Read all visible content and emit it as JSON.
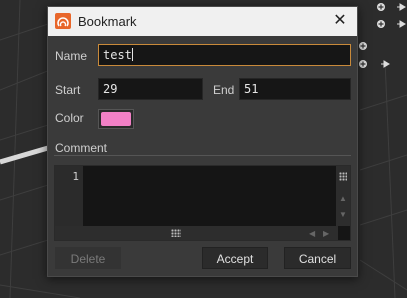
{
  "dialog": {
    "title": "Bookmark",
    "close_glyph": "✕",
    "name_label": "Name",
    "name_value": "test",
    "start_label": "Start",
    "start_value": "29",
    "end_label": "End",
    "end_value": "51",
    "color_label": "Color",
    "color_value": "#f280c6",
    "comment_label": "Comment",
    "line_number": "1",
    "delete_label": "Delete",
    "accept_label": "Accept",
    "cancel_label": "Cancel"
  },
  "icons": {
    "app": "houdini-logo-icon",
    "close": "close-icon"
  },
  "colors": {
    "accent_border": "#c98a3a",
    "app_icon": "#e8662a"
  }
}
